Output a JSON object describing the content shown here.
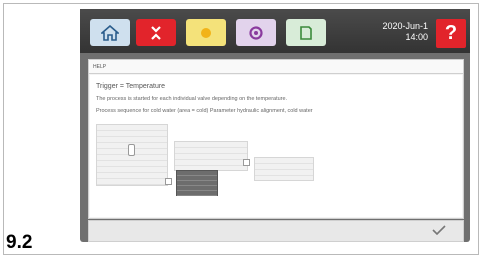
{
  "figure_label": "9.2",
  "header": {
    "tabs": [
      {
        "icon": "home-icon",
        "color": "#cfe0ee"
      },
      {
        "icon": "valves-icon",
        "color": "#e2242b"
      },
      {
        "icon": "temperature-icon",
        "color": "#f4e27a"
      },
      {
        "icon": "settings-gear-icon",
        "color": "#e2d3ec"
      },
      {
        "icon": "document-icon",
        "color": "#d8ecd8"
      }
    ],
    "date": "2020-Jun-1",
    "time": "14:00",
    "help_label": "?"
  },
  "panel": {
    "title": "HELP",
    "heading": "Trigger = Temperature",
    "description": "The process is started for each individual valve depending on the temperature.",
    "sequence": "Process sequence for cold water (area = cold) Parameter hydraulic alignment, cold water"
  },
  "footer": {
    "ok_icon": "checkmark-icon"
  }
}
